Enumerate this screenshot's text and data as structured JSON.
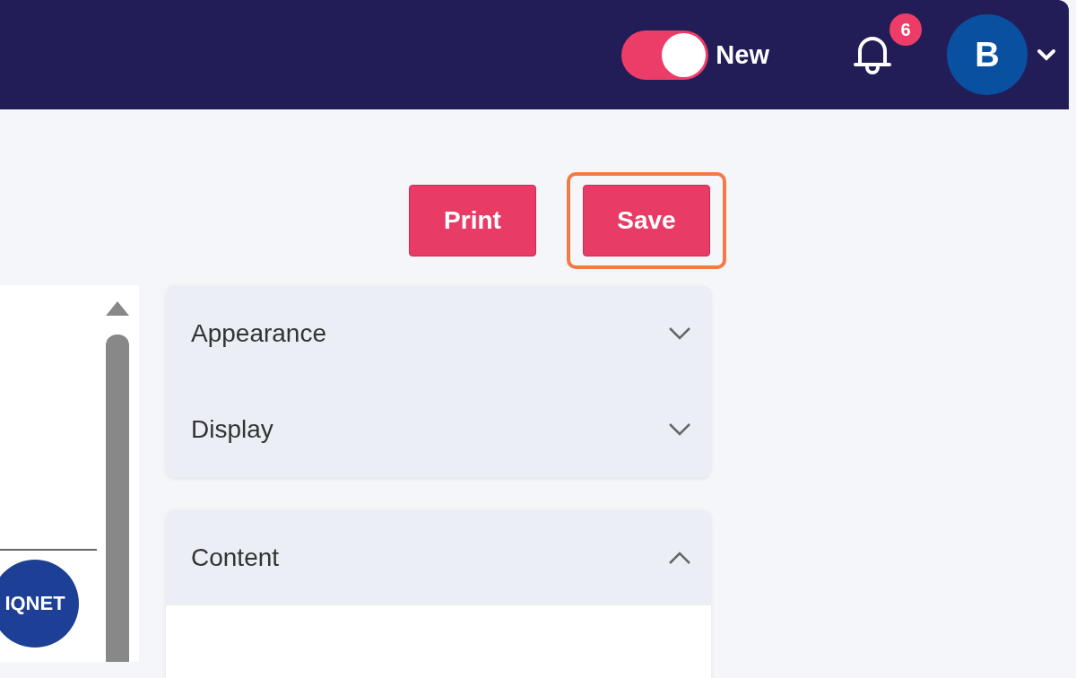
{
  "topbar": {
    "toggle": {
      "label": "New",
      "on": true
    },
    "notifications": {
      "count": "6"
    },
    "avatar": {
      "initial": "B"
    }
  },
  "actions": [
    {
      "label": "Print",
      "highlighted": false
    },
    {
      "label": "Save",
      "highlighted": true
    }
  ],
  "preview": {
    "logo_text": "IQNET"
  },
  "panels": [
    {
      "sections": [
        {
          "title": "Appearance",
          "expanded": false
        },
        {
          "title": "Display",
          "expanded": false
        }
      ]
    },
    {
      "sections": [
        {
          "title": "Content",
          "expanded": true
        }
      ]
    }
  ]
}
